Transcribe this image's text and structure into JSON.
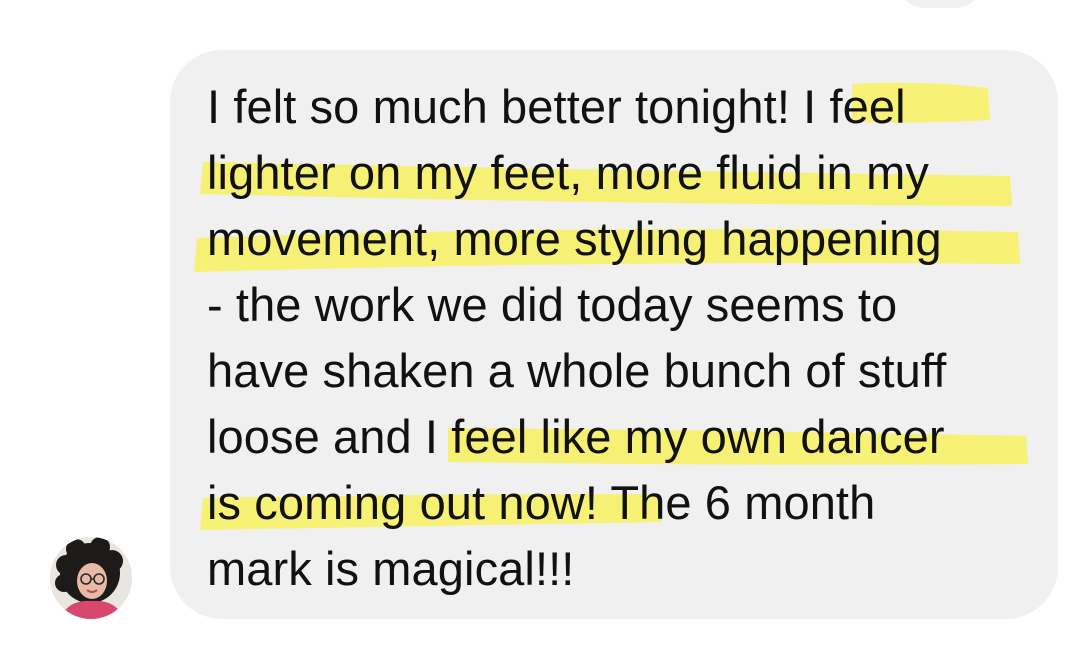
{
  "conversation": {
    "message": {
      "sender_avatar_icon": "user-avatar-photo",
      "bubble_color": "#f0f0f1",
      "highlight_color": "#f7f16a",
      "lines": [
        {
          "pre": "I felt so much better tonight! ",
          "hl": "I feel",
          "post": ""
        },
        {
          "pre": "",
          "hl": "lighter on my feet, more fluid in my",
          "post": ""
        },
        {
          "pre": "",
          "hl": "movement, more styling happening",
          "post": ""
        },
        {
          "pre": "- the work we did today seems to",
          "hl": "",
          "post": ""
        },
        {
          "pre": "have shaken a whole bunch of stuff",
          "hl": "",
          "post": ""
        },
        {
          "pre": "loose and I ",
          "hl": "feel like my own dancer",
          "post": ""
        },
        {
          "pre": "",
          "hl": "is coming out now!",
          "post": " The 6 month"
        },
        {
          "pre": "mark is magical!!!",
          "hl": "",
          "post": ""
        }
      ]
    }
  }
}
